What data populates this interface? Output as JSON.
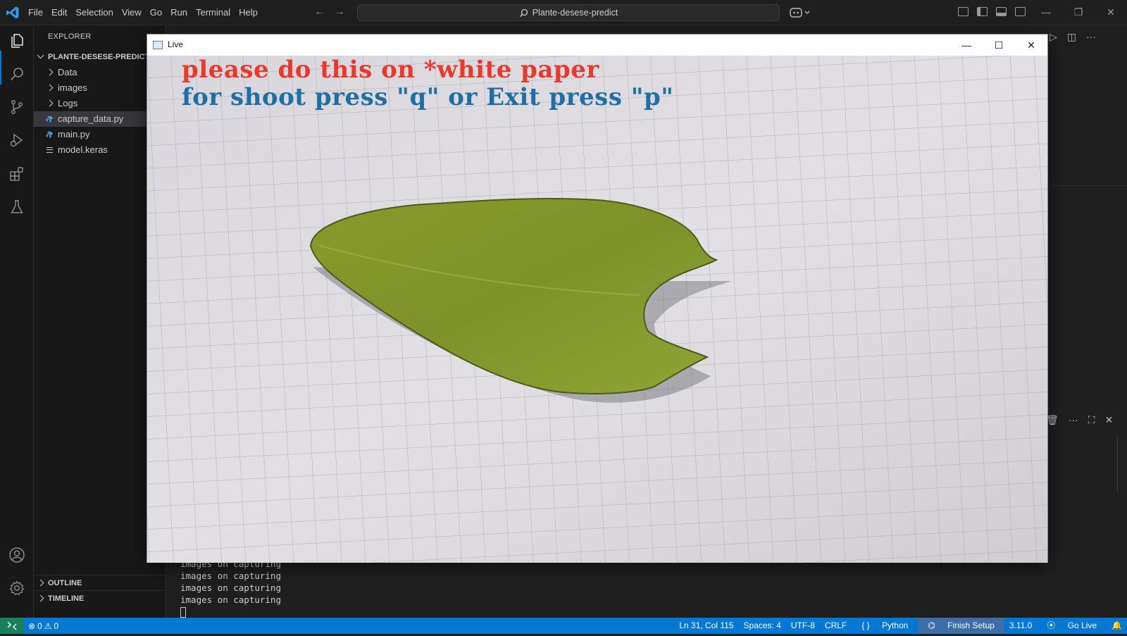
{
  "titlebar": {
    "menu": [
      "File",
      "Edit",
      "Selection",
      "View",
      "Go",
      "Run",
      "Terminal",
      "Help"
    ],
    "search_text": "Plante-desese-predict"
  },
  "activity_bar": {
    "icons": [
      "files-icon",
      "search-icon",
      "source-control-icon",
      "run-debug-icon",
      "extensions-icon",
      "testing-icon",
      "account-icon",
      "settings-gear-icon"
    ]
  },
  "sidebar": {
    "title": "EXPLORER",
    "root": "PLANTE-DESESE-PREDICT",
    "items": [
      {
        "label": "Data",
        "type": "folder"
      },
      {
        "label": "images",
        "type": "folder"
      },
      {
        "label": "Logs",
        "type": "folder"
      },
      {
        "label": "capture_data.py",
        "type": "python",
        "selected": true
      },
      {
        "label": "main.py",
        "type": "python"
      },
      {
        "label": "model.keras",
        "type": "file"
      }
    ],
    "sections": [
      "OUTLINE",
      "TIMELINE"
    ]
  },
  "terminal": {
    "lines": [
      "images on capturing",
      "images on capturing",
      "images on capturing",
      "images on capturing"
    ]
  },
  "live_window": {
    "title": "Live",
    "overlay_line1": "please do this on *white paper",
    "overlay_line2": "for shoot press \"q\" or Exit press \"p\"",
    "overlay_line1_color": "#e8392d",
    "overlay_line2_color": "#1f6fa4"
  },
  "statusbar": {
    "errors": "0",
    "warnings": "0",
    "position": "Ln 31, Col 115",
    "spaces": "Spaces: 4",
    "encoding": "UTF-8",
    "eol": "CRLF",
    "language": "Python",
    "finish_setup": "Finish Setup",
    "python_version": "3.11.0",
    "go_live": "Go Live",
    "accent": "#0078d4"
  }
}
